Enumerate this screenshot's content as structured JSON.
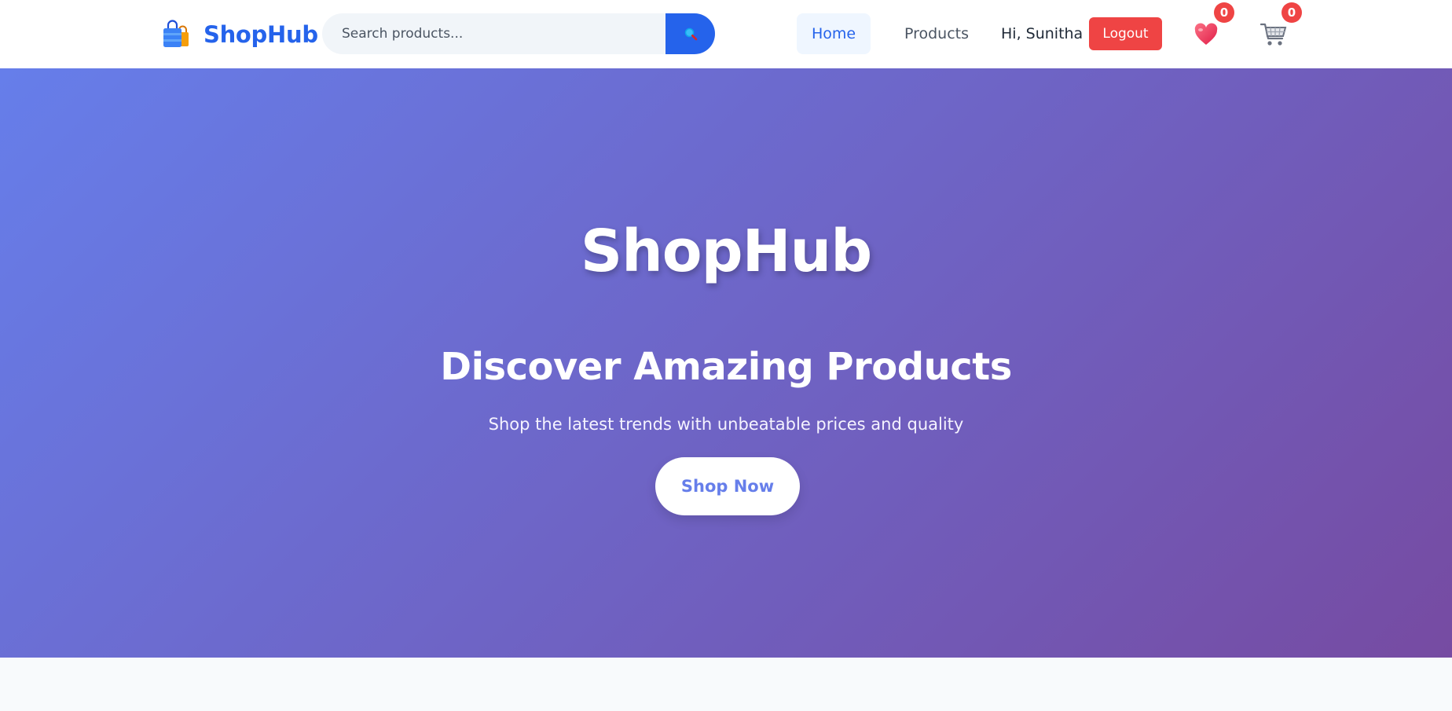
{
  "header": {
    "brand": {
      "name": "ShopHub",
      "logo_icon": "shopping-bags-icon"
    },
    "search": {
      "placeholder": "Search products...",
      "value": "",
      "button_icon": "search-icon"
    },
    "nav": [
      {
        "label": "Home",
        "active": true
      },
      {
        "label": "Products",
        "active": false
      }
    ],
    "user": {
      "greeting": "Hi, Sunitha",
      "logout_label": "Logout"
    },
    "wishlist": {
      "icon": "heart-icon",
      "count": "0"
    },
    "cart": {
      "icon": "cart-icon",
      "count": "0"
    }
  },
  "hero": {
    "title": "ShopHub",
    "subtitle": "Discover Amazing Products",
    "tagline": "Shop the latest trends with unbeatable prices and quality",
    "cta_label": "Shop Now"
  },
  "colors": {
    "brand_primary": "#2563eb",
    "logout": "#ef4444",
    "badge": "#ef4444",
    "hero_gradient_start": "#667eea",
    "hero_gradient_end": "#764ba2"
  }
}
